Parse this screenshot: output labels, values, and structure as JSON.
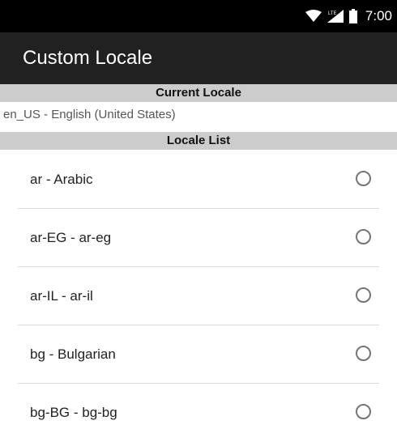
{
  "status_bar": {
    "network_label": "LTE",
    "time": "7:00"
  },
  "app_bar": {
    "title": "Custom Locale"
  },
  "current_locale": {
    "header": "Current Locale",
    "value": "en_US - English (United States)"
  },
  "locale_list": {
    "header": "Locale List",
    "items": [
      {
        "label": "ar - Arabic",
        "selected": false
      },
      {
        "label": "ar-EG - ar-eg",
        "selected": false
      },
      {
        "label": "ar-IL - ar-il",
        "selected": false
      },
      {
        "label": "bg - Bulgarian",
        "selected": false
      },
      {
        "label": "bg-BG - bg-bg",
        "selected": false
      }
    ]
  }
}
